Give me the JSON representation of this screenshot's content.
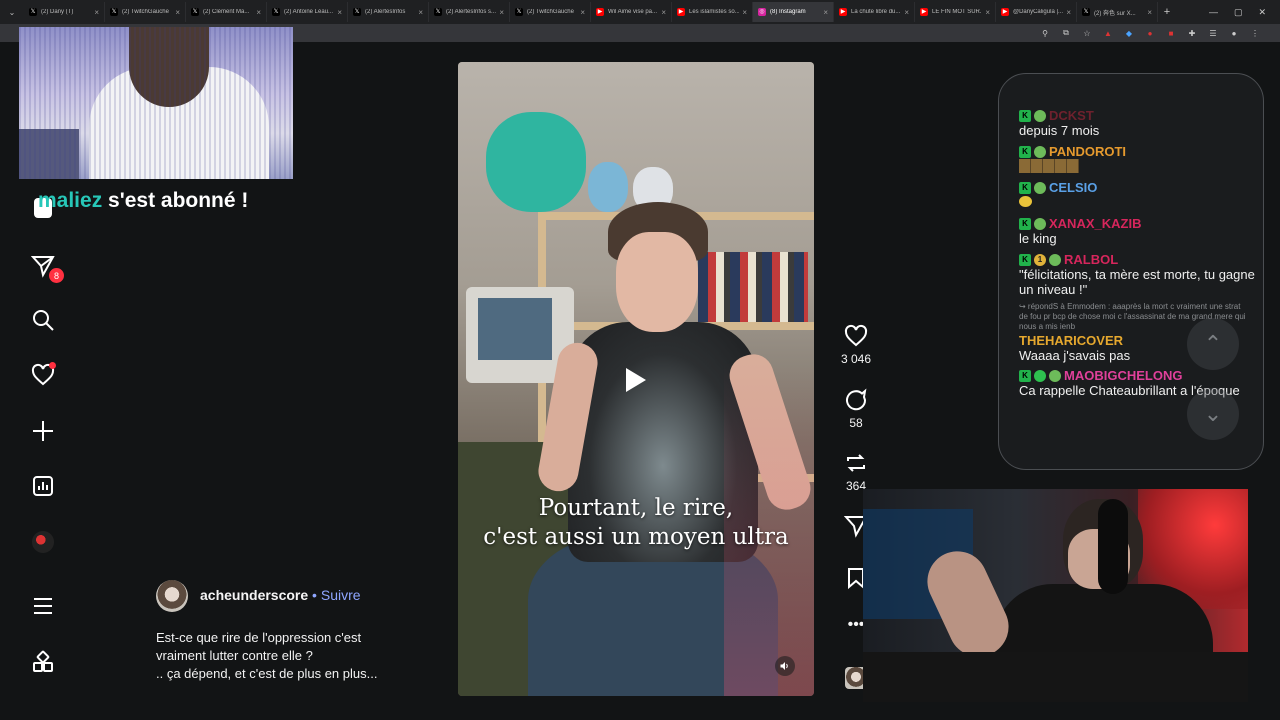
{
  "browser": {
    "tabs": [
      {
        "title": "(2) Dany (T)",
        "icon": "x-icon",
        "color": "#000000"
      },
      {
        "title": "(2) TwitchGauche",
        "icon": "x-icon",
        "color": "#000000"
      },
      {
        "title": "(2) Clément Ma...",
        "icon": "x-icon",
        "color": "#000000"
      },
      {
        "title": "(2) Antoine Léau...",
        "icon": "x-icon",
        "color": "#000000"
      },
      {
        "title": "(2) AlertesInfos",
        "icon": "x-icon",
        "color": "#000000"
      },
      {
        "title": "(2) AlertesInfos s...",
        "icon": "x-icon",
        "color": "#000000"
      },
      {
        "title": "(2) TwitchGauche",
        "icon": "x-icon",
        "color": "#000000"
      },
      {
        "title": "Wil Aime vise pa...",
        "icon": "youtube-icon",
        "color": "#ff0000"
      },
      {
        "title": "Les islamistes so...",
        "icon": "youtube-icon",
        "color": "#ff0000"
      },
      {
        "title": "(8) Instagram",
        "icon": "instagram-icon",
        "color": "#d6249f",
        "active": true
      },
      {
        "title": "La chute libre du...",
        "icon": "youtube-icon",
        "color": "#ff0000"
      },
      {
        "title": "LE FIN MOT SUR...",
        "icon": "youtube-icon",
        "color": "#ff0000"
      },
      {
        "title": "@DanyCaligula |...",
        "icon": "youtube-icon",
        "color": "#ff0000"
      },
      {
        "title": "(2) 奔色 sur X...",
        "icon": "x-icon",
        "color": "#000000"
      }
    ]
  },
  "alert": {
    "username": "maliez",
    "message": " s'est abonné !"
  },
  "sidebar": {
    "notifications_count": "8"
  },
  "reel": {
    "caption_line1": "Pourtant, le rire,",
    "caption_line2": "c'est aussi un moyen ultra"
  },
  "actions": {
    "likes": "3 046",
    "comments": "58",
    "reposts": "364"
  },
  "post": {
    "author": "acheunderscore",
    "separator": " • ",
    "follow_label": "Suivre",
    "description_line1": "Est-ce que rire de l'oppression c'est",
    "description_line2": "vraiment lutter contre elle ?",
    "description_line3": ".. ça dépend, et c'est de plus en plus..."
  },
  "chat": {
    "messages": [
      {
        "user": "DCKST",
        "color": "#b3263a",
        "text": "depuis 7 mois"
      },
      {
        "user": "PANDOROTI",
        "color": "#e69a2e",
        "text": ""
      },
      {
        "user": "CELSIO",
        "color": "#5aa0e6",
        "text": ""
      },
      {
        "user": "XANAX_KAZIB",
        "color": "#d6265c",
        "text": "le king"
      },
      {
        "user": "RALBOL",
        "color": "#d6265c",
        "text": "\"félicitations, ta mère est morte, tu gagne un niveau !\""
      },
      {
        "user": "THEHARICOVER",
        "color": "#e6a82e",
        "text": "Waaaa j'savais pas"
      },
      {
        "user": "MAOBIGCHELONG",
        "color": "#e0409a",
        "text": "Ca rappelle Chateaubrillant a l'époque"
      }
    ],
    "reply_note": "↪ répondS à Emmodem : aaaprès la mort c vraiment une strat de fou pr bcp de chose moi c l'assassinat de ma grand mere qui nous a mis ienb"
  }
}
